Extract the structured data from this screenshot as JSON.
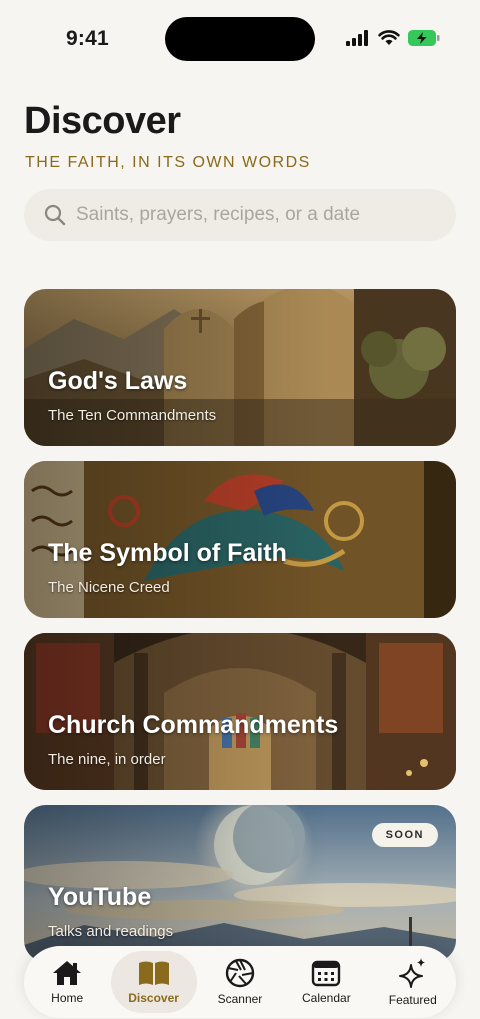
{
  "status": {
    "time": "9:41"
  },
  "header": {
    "title": "Discover",
    "subtitle": "THE FAITH, IN ITS OWN WORDS"
  },
  "search": {
    "placeholder": "Saints, prayers, recipes, or a date",
    "value": ""
  },
  "cards": [
    {
      "title": "God's Laws",
      "subtitle": "The Ten Commandments"
    },
    {
      "title": "The Symbol of Faith",
      "subtitle": "The Nicene Creed"
    },
    {
      "title": "Church Commandments",
      "subtitle": "The nine, in order"
    },
    {
      "title": "YouTube",
      "subtitle": "Talks and readings",
      "badge": "SOON"
    }
  ],
  "tabs": [
    {
      "label": "Home",
      "icon": "home-icon"
    },
    {
      "label": "Discover",
      "icon": "book-icon",
      "active": true
    },
    {
      "label": "Scanner",
      "icon": "aperture-icon"
    },
    {
      "label": "Calendar",
      "icon": "calendar-icon"
    },
    {
      "label": "Featured",
      "icon": "sparkle-icon"
    }
  ],
  "colors": {
    "accent": "#8a6a1c",
    "background": "#f7f5f1"
  }
}
